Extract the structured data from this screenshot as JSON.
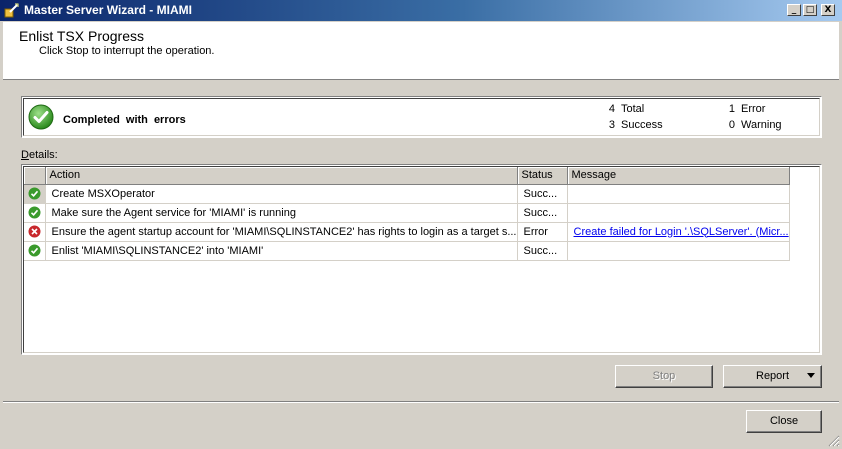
{
  "window": {
    "title": "Master Server Wizard - MIAMI",
    "minimize": "_",
    "maximize": "□",
    "close": "X"
  },
  "header": {
    "title": "Enlist TSX Progress",
    "subtitle": "Click Stop to interrupt the operation."
  },
  "status": {
    "text": "Completed with errors",
    "icon": "success-check-icon",
    "total_count": "4",
    "total_label": "Total",
    "success_count": "3",
    "success_label": "Success",
    "error_count": "1",
    "error_label": "Error",
    "warning_count": "0",
    "warning_label": "Warning"
  },
  "details": {
    "label_accel": "D",
    "label_rest": "etails:",
    "columns": [
      "Action",
      "Status",
      "Message"
    ],
    "rows": [
      {
        "icon": "success-icon",
        "action": "Create MSXOperator",
        "status": "Succ...",
        "message": ""
      },
      {
        "icon": "success-icon",
        "action": "Make sure the Agent service for 'MIAMI' is running",
        "status": "Succ...",
        "message": ""
      },
      {
        "icon": "error-icon",
        "action": "Ensure the agent startup account for 'MIAMI\\SQLINSTANCE2' has rights to login as a target s...",
        "status": "Error",
        "message": "Create failed for Login '.\\SQLServer'. (Micr..."
      },
      {
        "icon": "success-icon",
        "action": "Enlist 'MIAMI\\SQLINSTANCE2' into 'MIAMI'",
        "status": "Succ...",
        "message": ""
      }
    ]
  },
  "buttons": {
    "stop": "Stop",
    "report": "Report",
    "close": "Close"
  },
  "colors": {
    "success": "#3a9a2c",
    "error": "#c8282c",
    "link": "#0000ee",
    "face": "#d4d0c8"
  }
}
